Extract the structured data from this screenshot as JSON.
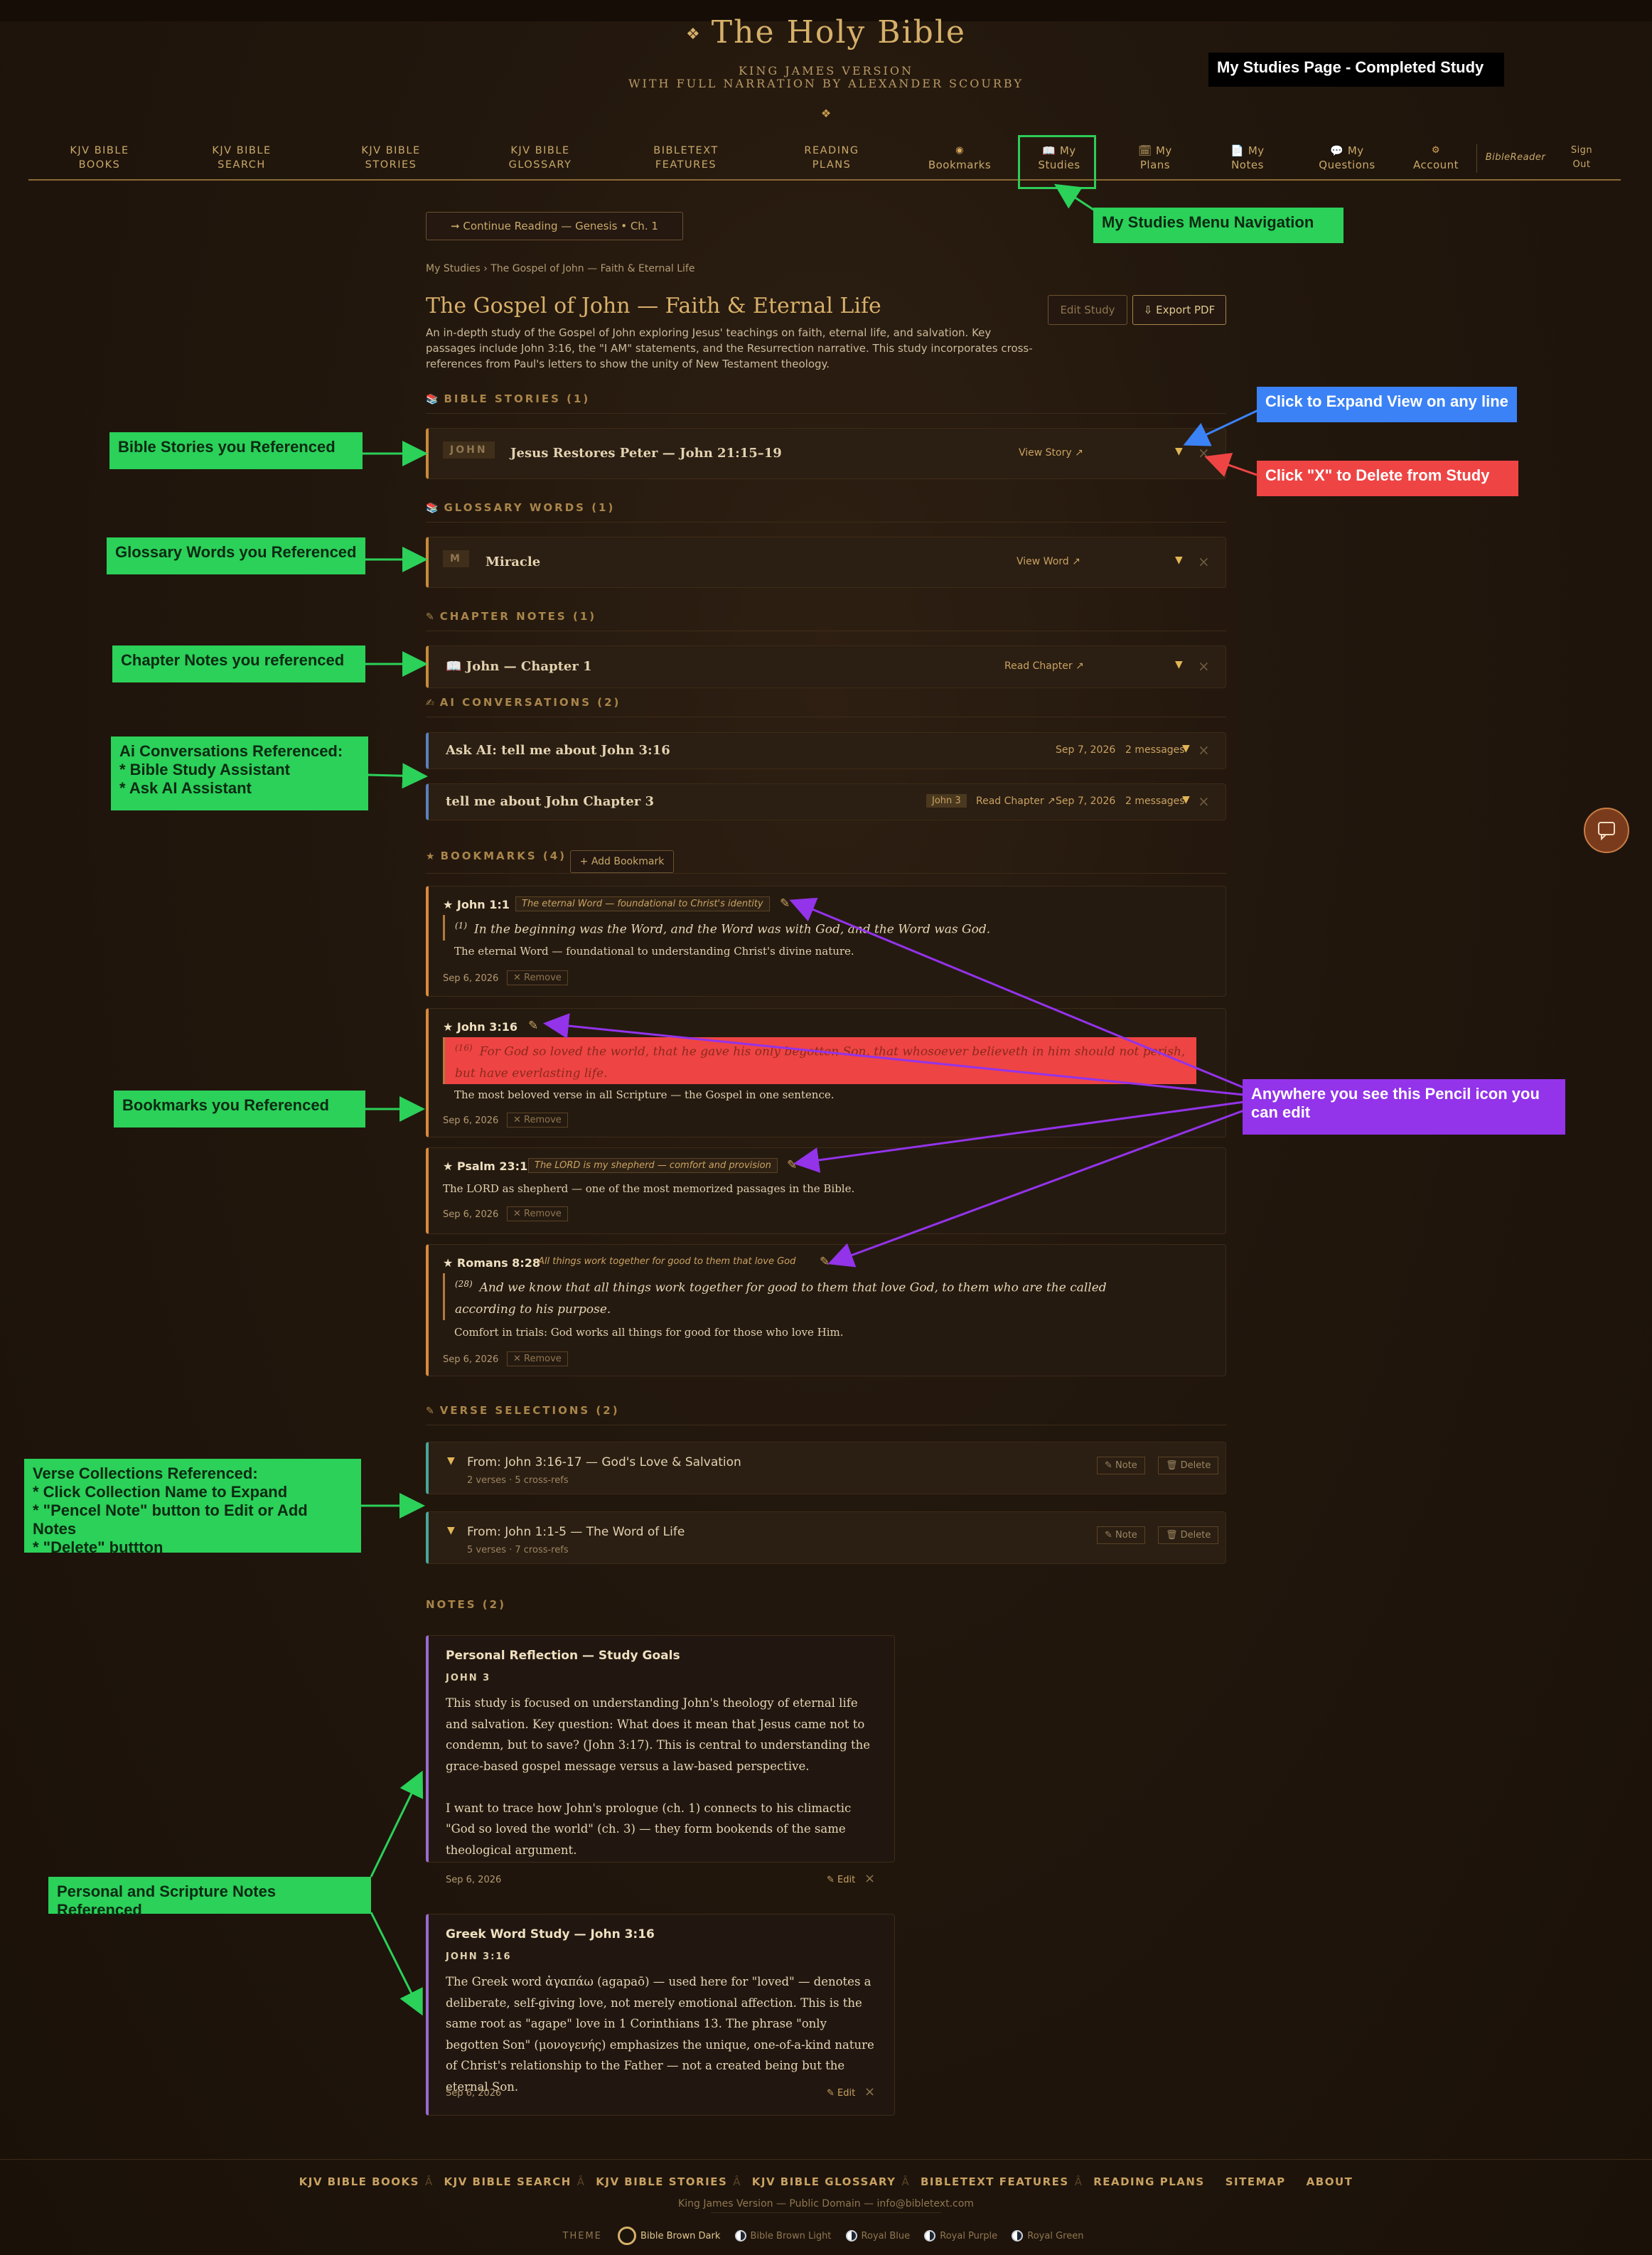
{
  "header": {
    "title": "The Holy Bible",
    "subtitle1": "KING JAMES VERSION",
    "subtitle2": "WITH FULL NARRATION BY ALEXANDER SCOURBY",
    "ornament": "❖"
  },
  "nav": {
    "kjv_books": [
      "KJV BIBLE",
      "BOOKS"
    ],
    "kjv_search": [
      "KJV BIBLE",
      "SEARCH"
    ],
    "kjv_stories": [
      "KJV BIBLE",
      "STORIES"
    ],
    "kjv_glossary": [
      "KJV BIBLE",
      "GLOSSARY"
    ],
    "features": [
      "BIBLETEXT",
      "FEATURES"
    ],
    "plans": [
      "READING",
      "PLANS"
    ],
    "bookmarks": "Bookmarks",
    "my_studies": [
      "My",
      "Studies"
    ],
    "my_plans": [
      "My",
      "Plans"
    ],
    "my_notes": [
      "My",
      "Notes"
    ],
    "my_questions": [
      "My",
      "Questions"
    ],
    "account": "Account",
    "biblereader": "BibleReader",
    "sign_out": [
      "Sign",
      "Out"
    ]
  },
  "continue_reading": "➞ Continue Reading — Genesis • Ch. 1",
  "breadcrumb": "My Studies › The Gospel of John — Faith & Eternal Life",
  "study": {
    "title": "The Gospel of John — Faith & Eternal Life",
    "description": "An in-depth study of the Gospel of John exploring Jesus' teachings on faith, eternal life, and salvation. Key passages include John 3:16, the \"I AM\" statements, and the Resurrection narrative. This study incorporates cross-references from Paul's letters to show the unity of New Testament theology.",
    "edit_label": "Edit Study",
    "export_label": "⇩ Export PDF"
  },
  "sections": {
    "stories": "BIBLE STORIES (1)",
    "glossary": "GLOSSARY WORDS (1)",
    "chapter_notes": "CHAPTER NOTES (1)",
    "ai": "AI CONVERSATIONS (2)",
    "bookmarks": "BOOKMARKS (4)",
    "add_bookmark": "+ Add Bookmark",
    "verse_selections": "VERSE SELECTIONS (2)",
    "notes": "NOTES (2)"
  },
  "story_row": {
    "badge": "JOHN",
    "title": "Jesus Restores Peter — John 21:15–19",
    "link": "View Story ↗"
  },
  "glossary_row": {
    "badge": "M",
    "title": "Miracle",
    "link": "View Word ↗"
  },
  "chapter_row": {
    "title": "📖 John — Chapter 1",
    "link": "Read Chapter ↗"
  },
  "ai_rows": [
    {
      "title": "Ask AI: tell me about John 3:16",
      "date": "Sep 7, 2026",
      "messages": "2 messages"
    },
    {
      "title": "tell me about John Chapter 3",
      "tag": "John 3",
      "link": "Read Chapter ↗",
      "date": "Sep 7, 2026",
      "messages": "2 messages"
    }
  ],
  "bookmarks": [
    {
      "ref": "★ John 1:1",
      "tag": "The eternal Word — foundational to Christ's identity",
      "verse_num": "(1)",
      "verse": "In the beginning was the Word, and the Word was with God, and the Word was God.",
      "note": "The eternal Word — foundational to understanding Christ's divine nature.",
      "date": "Sep 6, 2026",
      "remove": "✕ Remove"
    },
    {
      "ref": "★ John 3:16",
      "verse_num": "(16)",
      "verse": "For God so loved the world, that he gave his only begotten Son, that whosoever believeth in him should not perish, but have everlasting life.",
      "note": "The most beloved verse in all Scripture — the Gospel in one sentence.",
      "date": "Sep 6, 2026",
      "remove": "✕ Remove"
    },
    {
      "ref": "★ Psalm 23:1",
      "tag": "The LORD is my shepherd — comfort and provision",
      "note": "The LORD as shepherd — one of the most memorized passages in the Bible.",
      "date": "Sep 6, 2026",
      "remove": "✕ Remove"
    },
    {
      "ref": "★ Romans 8:28",
      "tag": "All things work together for good to them that love God",
      "verse_num": "(28)",
      "verse": "And we know that all things work together for good to them that love God, to them who are the called according to his purpose.",
      "note": "Comfort in trials: God works all things for good for those who love Him.",
      "date": "Sep 6, 2026",
      "remove": "✕ Remove"
    }
  ],
  "verse_selections": [
    {
      "title": "From: John 3:16-17 — God's Love & Salvation",
      "sub": "2 verses · 5 cross-refs",
      "note": "✎ Note",
      "delete": "🗑 Delete"
    },
    {
      "title": "From: John 1:1-5 — The Word of Life",
      "sub": "5 verses · 7 cross-refs",
      "note": "✎ Note",
      "delete": "🗑 Delete"
    }
  ],
  "notes": [
    {
      "title": "Personal Reflection — Study Goals",
      "ref": "JOHN 3",
      "body": "This study is focused on understanding John's theology of eternal life and salvation. Key question: What does it mean that Jesus came not to condemn, but to save? (John 3:17). This is central to understanding the grace-based gospel message versus a law-based perspective.\n\nI want to trace how John's prologue (ch. 1) connects to his climactic \"God so loved the world\" (ch. 3) — they form bookends of the same theological argument.",
      "date": "Sep 6, 2026",
      "edit": "✎ Edit"
    },
    {
      "title": "Greek Word Study — John 3:16",
      "ref": "JOHN 3:16",
      "body": "The Greek word ἀγαπάω (agapaō) — used here for \"loved\" — denotes a deliberate, self-giving love, not merely emotional affection. This is the same root as \"agape\" love in 1 Corinthians 13. The phrase \"only begotten Son\" (μονογενής) emphasizes the unique, one-of-a-kind nature of Christ's relationship to the Father — not a created being but the eternal Son.",
      "date": "Sep 6, 2026",
      "edit": "✎ Edit"
    }
  ],
  "callouts": {
    "page_label": "My Studies Page - Completed Study",
    "menu_nav": "My Studies Menu Navigation",
    "expand": "Click to Expand View on any line",
    "delete": "Click \"X\" to Delete from Study",
    "stories": "Bible Stories you Referenced",
    "glossary": "Glossary Words you Referenced",
    "chapter": "Chapter Notes you referenced",
    "ai": "Ai Conversations Referenced:\n* Bible Study Assistant\n* Ask AI  Assistant",
    "bookmarks": "Bookmarks you Referenced",
    "pencil": "Anywhere you see this Pencil icon you can edit",
    "verse": "Verse Collections Referenced:\n* Click Collection Name to Expand\n* \"Pencel Note\" button to Edit or Add Notes\n* \"Delete\" buttton",
    "notes": "Personal and Scripture Notes Referenced"
  },
  "footer": {
    "links": [
      "KJV BIBLE BOOKS",
      "KJV BIBLE SEARCH",
      "KJV BIBLE STORIES",
      "KJV BIBLE GLOSSARY",
      "BIBLETEXT FEATURES",
      "READING PLANS",
      "SITEMAP",
      "ABOUT"
    ],
    "link_sep": "Â",
    "copyright": "King James Version — Public Domain — info@bibletext.com",
    "theme_label": "THEME",
    "themes": [
      "Bible Brown Dark",
      "Bible Brown Light",
      "Royal Blue",
      "Royal Purple",
      "Royal Green"
    ]
  },
  "colors": {
    "accent": "#d6b06a",
    "background": "#22170d",
    "callout_green": "#2bd159",
    "callout_blue": "#3b82f6",
    "callout_red": "#ef4444",
    "callout_purple": "#9333ea"
  }
}
